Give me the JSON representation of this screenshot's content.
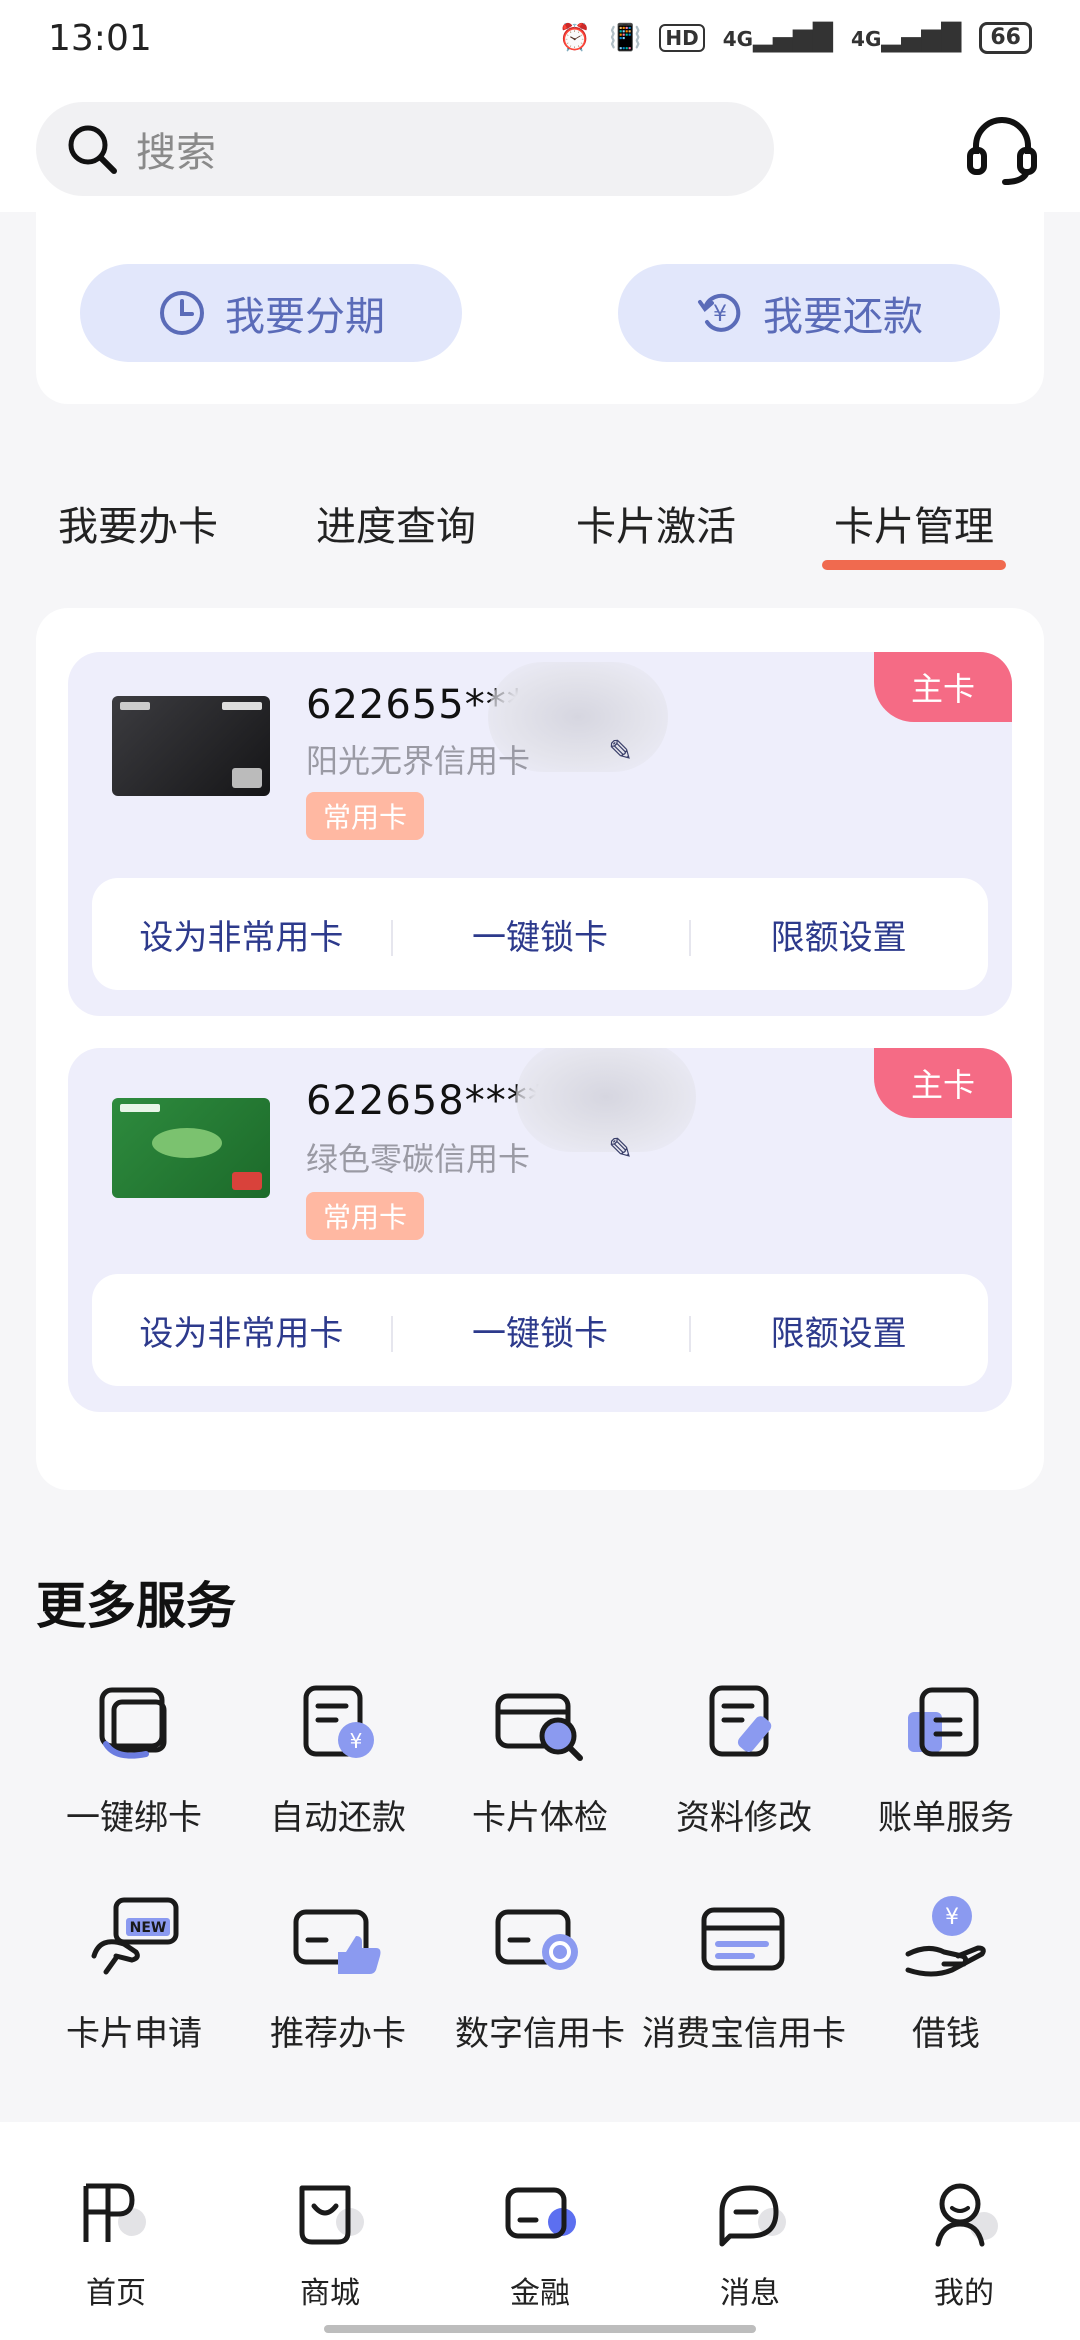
{
  "status": {
    "time": "13:01",
    "net1": "4G",
    "net2": "4G",
    "hd": "HD",
    "battery": "66"
  },
  "header": {
    "search_placeholder": "搜索"
  },
  "quick_actions": {
    "installment": "我要分期",
    "repay": "我要还款"
  },
  "tabs": [
    {
      "label": "我要办卡"
    },
    {
      "label": "进度查询"
    },
    {
      "label": "卡片激活"
    },
    {
      "label": "卡片管理",
      "active": true
    }
  ],
  "cards": [
    {
      "number": "622655***",
      "name": "阳光无界信用卡",
      "tag": "常用卡",
      "badge": "主卡",
      "actions": [
        "设为非常用卡",
        "一键锁卡",
        "限额设置"
      ]
    },
    {
      "number": "622658*****",
      "name": "绿色零碳信用卡",
      "tag": "常用卡",
      "badge": "主卡",
      "actions": [
        "设为非常用卡",
        "一键锁卡",
        "限额设置"
      ]
    }
  ],
  "more_services": {
    "title": "更多服务",
    "items": [
      {
        "label": "一键绑卡",
        "icon": "phone-bind-icon"
      },
      {
        "label": "自动还款",
        "icon": "auto-repay-icon"
      },
      {
        "label": "卡片体检",
        "icon": "card-check-icon"
      },
      {
        "label": "资料修改",
        "icon": "edit-info-icon"
      },
      {
        "label": "账单服务",
        "icon": "bill-icon"
      },
      {
        "label": "卡片申请",
        "icon": "card-apply-new-icon"
      },
      {
        "label": "推荐办卡",
        "icon": "recommend-card-icon"
      },
      {
        "label": "数字信用卡",
        "icon": "digital-card-icon"
      },
      {
        "label": "消费宝信用卡",
        "icon": "consume-card-icon"
      },
      {
        "label": "借钱",
        "icon": "borrow-money-icon"
      }
    ]
  },
  "bottom_nav": [
    {
      "label": "首页",
      "icon": "home-icon"
    },
    {
      "label": "商城",
      "icon": "shop-icon"
    },
    {
      "label": "金融",
      "icon": "finance-icon",
      "active": true
    },
    {
      "label": "消息",
      "icon": "message-icon"
    },
    {
      "label": "我的",
      "icon": "profile-icon"
    }
  ],
  "colors": {
    "accent": "#f06a4f",
    "pill_bg": "#e2e7fb",
    "badge_main": "#f56b85",
    "badge_common": "#ffb8a2",
    "action_text": "#2d3a8c"
  }
}
